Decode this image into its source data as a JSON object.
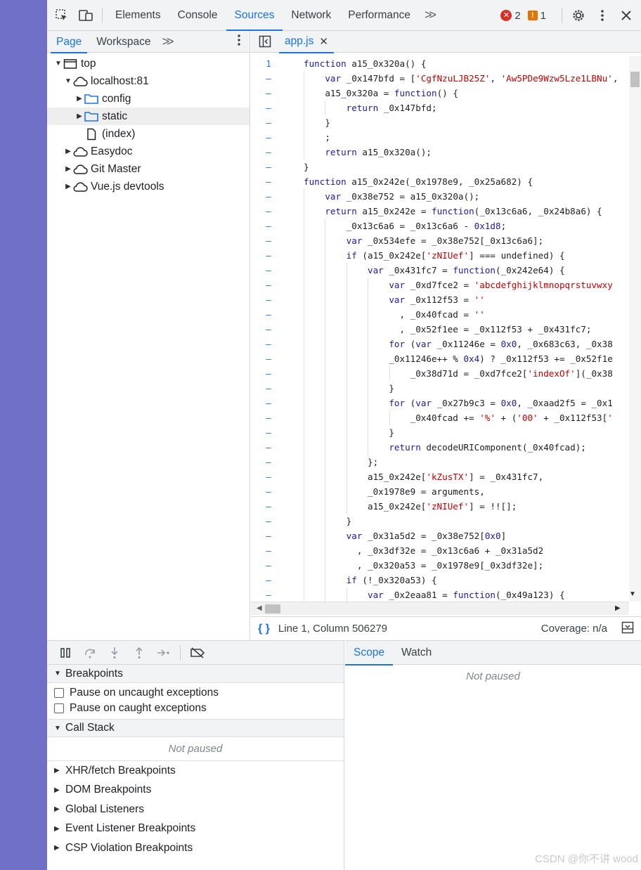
{
  "toolbar": {
    "tabs": [
      "Elements",
      "Console",
      "Sources",
      "Network",
      "Performance"
    ],
    "active_tab": "Sources",
    "errors_count": "2",
    "warnings_count": "1",
    "icons": [
      "inspect-element-icon",
      "device-toolbar-icon",
      "more-tabs-icon",
      "settings-icon",
      "more-options-icon",
      "close-icon"
    ]
  },
  "navigator": {
    "tabs": [
      "Page",
      "Workspace"
    ],
    "active_tab": "Page",
    "tree": [
      {
        "label": "top",
        "level": 0,
        "icon": "frame-icon",
        "expanded": true
      },
      {
        "label": "localhost:81",
        "level": 1,
        "icon": "cloud-icon",
        "expanded": true
      },
      {
        "label": "config",
        "level": 2,
        "icon": "folder-icon",
        "expanded": false
      },
      {
        "label": "static",
        "level": 2,
        "icon": "folder-icon",
        "expanded": false,
        "selected": true
      },
      {
        "label": "(index)",
        "level": 2,
        "icon": "file-icon"
      },
      {
        "label": "Easydoc",
        "level": 1,
        "icon": "cloud-icon",
        "expanded": false
      },
      {
        "label": "Git Master",
        "level": 1,
        "icon": "cloud-icon",
        "expanded": false
      },
      {
        "label": "Vue.js devtools",
        "level": 1,
        "icon": "cloud-icon",
        "expanded": false
      }
    ]
  },
  "editor": {
    "file_tab": "app.js",
    "first_line_number": "1",
    "other_line_marker": "–",
    "code_lines": [
      "function a15_0x320a() {",
      "    var _0x147bfd = ['CgfNzuLJB25Z', 'Aw5PDe9Wzw5Lze1LBNu',",
      "    a15_0x320a = function() {",
      "        return _0x147bfd;",
      "    }",
      "    ;",
      "    return a15_0x320a();",
      "}",
      "function a15_0x242e(_0x1978e9, _0x25a682) {",
      "    var _0x38e752 = a15_0x320a();",
      "    return a15_0x242e = function(_0x13c6a6, _0x24b8a6) {",
      "        _0x13c6a6 = _0x13c6a6 - 0x1d8;",
      "        var _0x534efe = _0x38e752[_0x13c6a6];",
      "        if (a15_0x242e['zNIUef'] === undefined) {",
      "            var _0x431fc7 = function(_0x242e64) {",
      "                var _0xd7fce2 = 'abcdefghijklmnopqrstuvwxy",
      "                var _0x112f53 = ''",
      "                  , _0x40fcad = ''",
      "                  , _0x52f1ee = _0x112f53 + _0x431fc7;",
      "                for (var _0x11246e = 0x0, _0x683c63, _0x38",
      "                _0x11246e++ % 0x4) ? _0x112f53 += _0x52f1e",
      "                    _0x38d71d = _0xd7fce2['indexOf'](_0x38",
      "                }",
      "                for (var _0x27b9c3 = 0x0, _0xaad2f5 = _0x1",
      "                    _0x40fcad += '%' + ('00' + _0x112f53['",
      "                }",
      "                return decodeURIComponent(_0x40fcad);",
      "            };",
      "            a15_0x242e['kZusTX'] = _0x431fc7,",
      "            _0x1978e9 = arguments,",
      "            a15_0x242e['zNIUef'] = !![];",
      "        }",
      "        var _0x31a5d2 = _0x38e752[0x0]",
      "          , _0x3df32e = _0x13c6a6 + _0x31a5d2",
      "          , _0x320a53 = _0x1978e9[_0x3df32e];",
      "        if (!_0x320a53) {",
      "            var _0x2eaa81 = function(_0x49a123) {"
    ],
    "status_position": "Line 1, Column 506279",
    "coverage": "Coverage: n/a"
  },
  "debugger": {
    "breakpoints_title": "Breakpoints",
    "pause_uncaught": "Pause on uncaught exceptions",
    "pause_caught": "Pause on caught exceptions",
    "call_stack_title": "Call Stack",
    "not_paused": "Not paused",
    "collapsed_sections": [
      "XHR/fetch Breakpoints",
      "DOM Breakpoints",
      "Global Listeners",
      "Event Listener Breakpoints",
      "CSP Violation Breakpoints"
    ]
  },
  "scope": {
    "tabs": [
      "Scope",
      "Watch"
    ],
    "active_tab": "Scope",
    "not_paused": "Not paused"
  },
  "watermark": "CSDN @你不讲 wood"
}
